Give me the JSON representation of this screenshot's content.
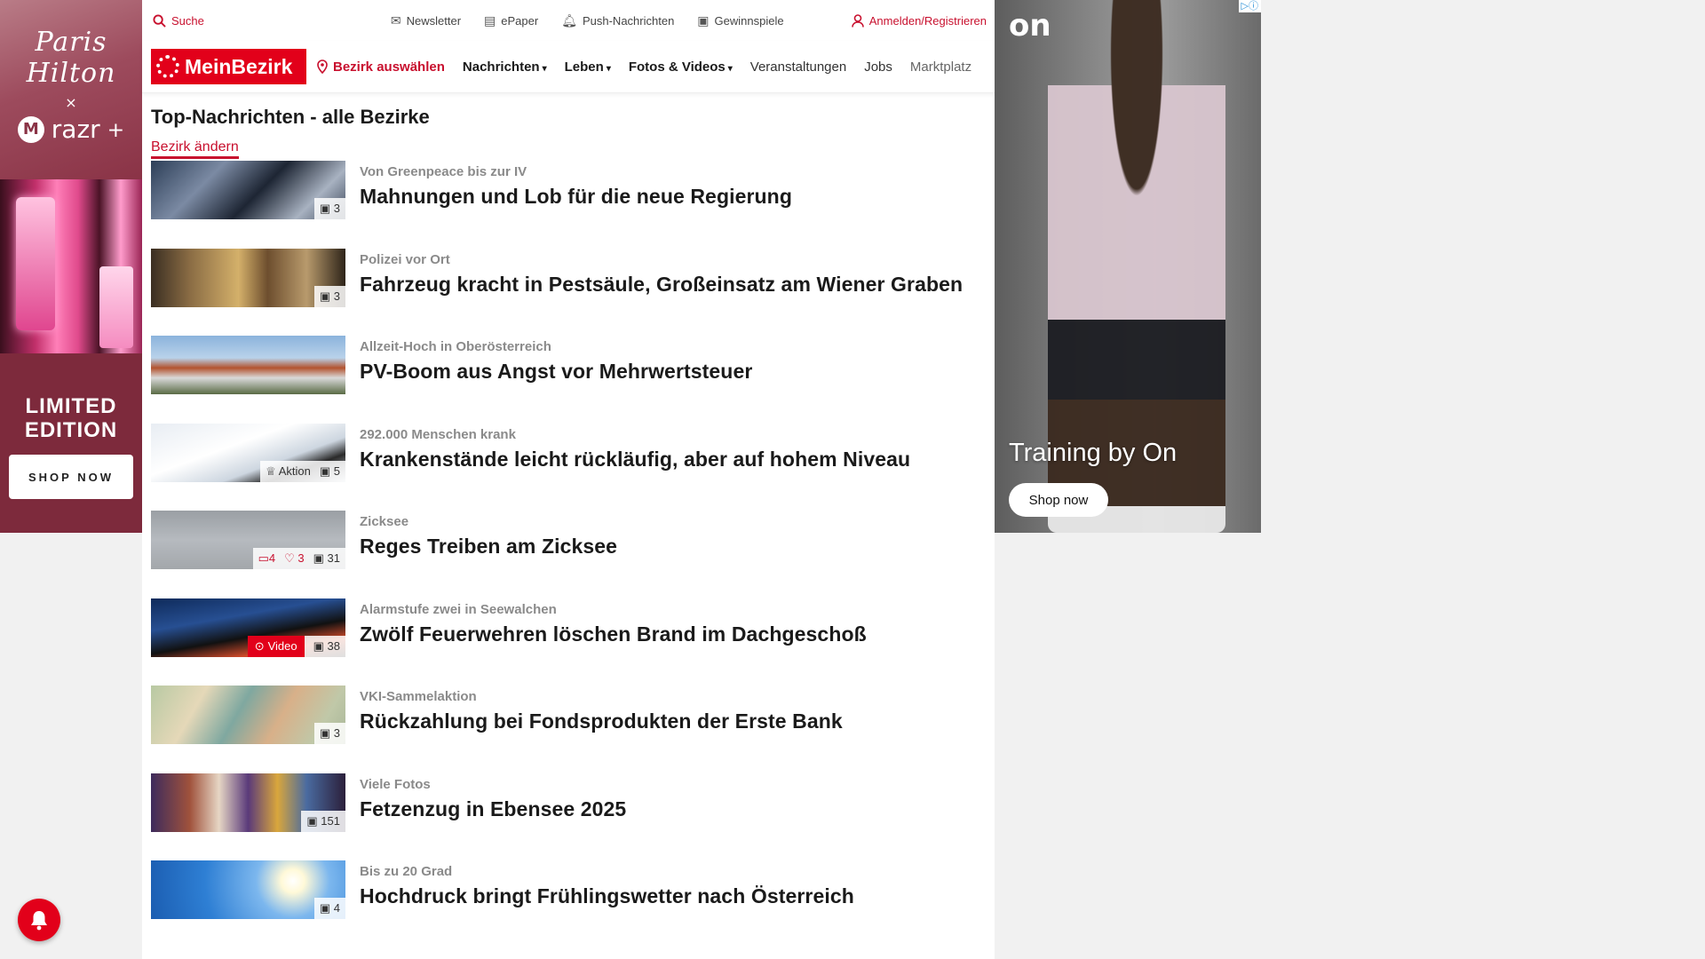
{
  "ad_left": {
    "brand_script": "Paris Hilton",
    "brand_x": "×",
    "brand_razr": "razr",
    "brand_razr_plus": "+",
    "moto_logo": "M",
    "headline_line1": "LIMITED",
    "headline_line2": "EDITION",
    "cta": "SHOP NOW",
    "adchoice": "▷ⓘ"
  },
  "topbar": {
    "search": "Suche",
    "newsletter": "Newsletter",
    "epaper": "ePaper",
    "push": "Push-Nachrichten",
    "games": "Gewinnspiele",
    "login": "Anmelden/Registrieren"
  },
  "nav": {
    "logo": "MeinBezirk",
    "bezirk": "Bezirk auswählen",
    "items": [
      "Nachrichten",
      "Leben",
      "Fotos & Videos",
      "Veranstaltungen",
      "Jobs",
      "Marktplatz"
    ]
  },
  "page": {
    "title": "Top-Nachrichten - alle Bezirke",
    "change_district": "Bezirk ändern"
  },
  "articles": [
    {
      "kicker": "Von Greenpeace bis zur IV",
      "headline": "Mahnungen und Lob für die neue Regierung",
      "photos": "3"
    },
    {
      "kicker": "Polizei vor Ort",
      "headline": "Fahrzeug kracht in Pestsäule, Großeinsatz am Wiener Graben",
      "photos": "3"
    },
    {
      "kicker": "Allzeit-Hoch in Oberösterreich",
      "headline": "PV-Boom aus Angst vor Mehrwertsteuer",
      "photos": ""
    },
    {
      "kicker": "292.000 Menschen krank",
      "headline": "Krankenstände leicht rückläufig, aber auf hohem Niveau",
      "aktion": "Aktion",
      "photos": "5"
    },
    {
      "kicker": "Zicksee",
      "headline": "Reges Treiben am Zicksee",
      "comments": "4",
      "likes": "3",
      "photos": "31"
    },
    {
      "kicker": "Alarmstufe zwei in Seewalchen",
      "headline": "Zwölf Feuerwehren löschen Brand im Dachgeschoß",
      "video": "Video",
      "photos": "38"
    },
    {
      "kicker": "VKI-Sammelaktion",
      "headline": "Rückzahlung bei Fondsprodukten der Erste Bank",
      "photos": "3"
    },
    {
      "kicker": "Viele Fotos",
      "headline": "Fetzenzug in Ebensee 2025",
      "photos": "151"
    },
    {
      "kicker": "Bis zu 20 Grad",
      "headline": "Hochdruck bringt Frühlingswetter nach Österreich",
      "photos": "4"
    }
  ],
  "ad_right": {
    "logo": "on",
    "tagline": "Training by On",
    "cta": "Shop now",
    "adchoice": "▷ⓘ"
  },
  "colors": {
    "brand_red": "#e2001a",
    "link_red": "#c8102e",
    "kicker_gray": "#8a8a8a"
  },
  "icons": {
    "search": "search-icon",
    "newsletter": "mail-icon",
    "epaper": "newspaper-icon",
    "push": "bell-icon",
    "games": "gift-icon",
    "login": "user-icon",
    "location": "location-pin-icon",
    "photos": "image-icon",
    "aktion": "trophy-icon",
    "comments": "comment-icon",
    "likes": "heart-icon",
    "video": "play-icon",
    "chevron": "chevron-down-icon"
  }
}
